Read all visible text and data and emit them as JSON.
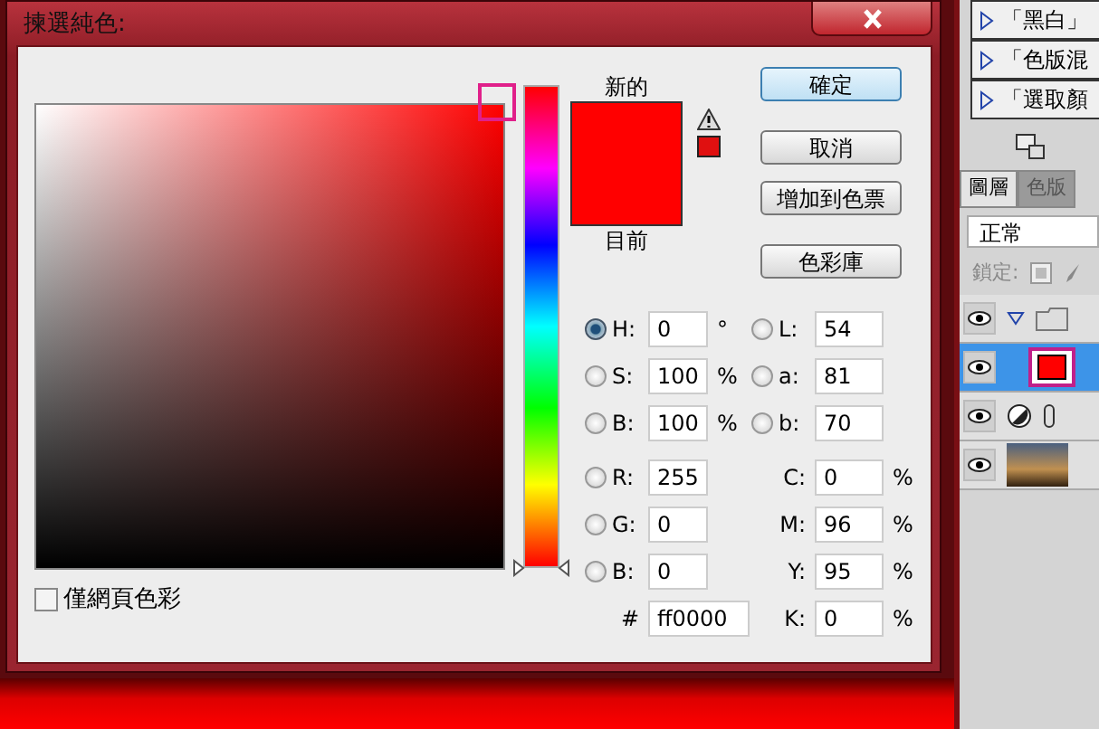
{
  "window": {
    "title": "揀選純色:"
  },
  "web_colors_only": {
    "label": "僅網頁色彩",
    "checked": false
  },
  "hue_slider": {
    "level": 0
  },
  "swatch": {
    "new_label": "新的",
    "current_label": "目前"
  },
  "buttons": [
    {
      "label": "確定",
      "default": true
    },
    {
      "label": "取消",
      "default": false
    },
    {
      "label": "增加到色票",
      "default": false
    },
    {
      "label": "色彩庫",
      "default": false
    }
  ],
  "left_fields": [
    {
      "kind": "radio",
      "label": "H:",
      "value": "0",
      "unit": "°",
      "selected": true
    },
    {
      "kind": "radio",
      "label": "S:",
      "value": "100",
      "unit": "%",
      "selected": false
    },
    {
      "kind": "radio",
      "label": "B:",
      "value": "100",
      "unit": "%",
      "selected": false
    },
    {
      "kind": "radio",
      "label": "R:",
      "value": "255",
      "selected": false
    },
    {
      "kind": "radio",
      "label": "G:",
      "value": "0",
      "selected": false
    },
    {
      "kind": "radio",
      "label": "B:",
      "value": "0",
      "selected": false
    },
    {
      "kind": "hex",
      "label": "#",
      "value": "ff0000"
    }
  ],
  "right_fields": [
    {
      "kind": "radio",
      "label": "L:",
      "value": "54",
      "selected": false
    },
    {
      "kind": "radio",
      "label": "a:",
      "value": "81",
      "selected": false
    },
    {
      "kind": "radio",
      "label": "b:",
      "value": "70",
      "selected": false
    },
    {
      "kind": "plain",
      "label": "C:",
      "value": "0",
      "unit": "%"
    },
    {
      "kind": "plain",
      "label": "M:",
      "value": "96",
      "unit": "%"
    },
    {
      "kind": "plain",
      "label": "Y:",
      "value": "95",
      "unit": "%"
    },
    {
      "kind": "plain",
      "label": "K:",
      "value": "0",
      "unit": "%"
    }
  ],
  "history": [
    {
      "label": "「黑白」"
    },
    {
      "label": "「色版混"
    },
    {
      "label": "「選取顏"
    }
  ],
  "panel_tabs": [
    {
      "label": "圖層",
      "selected": true
    },
    {
      "label": "色版",
      "selected": false
    }
  ],
  "blend_mode": "正常",
  "lock_label": "鎖定:",
  "layers": [
    {
      "kind": "group",
      "expanded": true,
      "selected": false
    },
    {
      "kind": "fill",
      "selected": true
    },
    {
      "kind": "adjustment",
      "selected": false
    },
    {
      "kind": "photo",
      "selected": false
    }
  ]
}
